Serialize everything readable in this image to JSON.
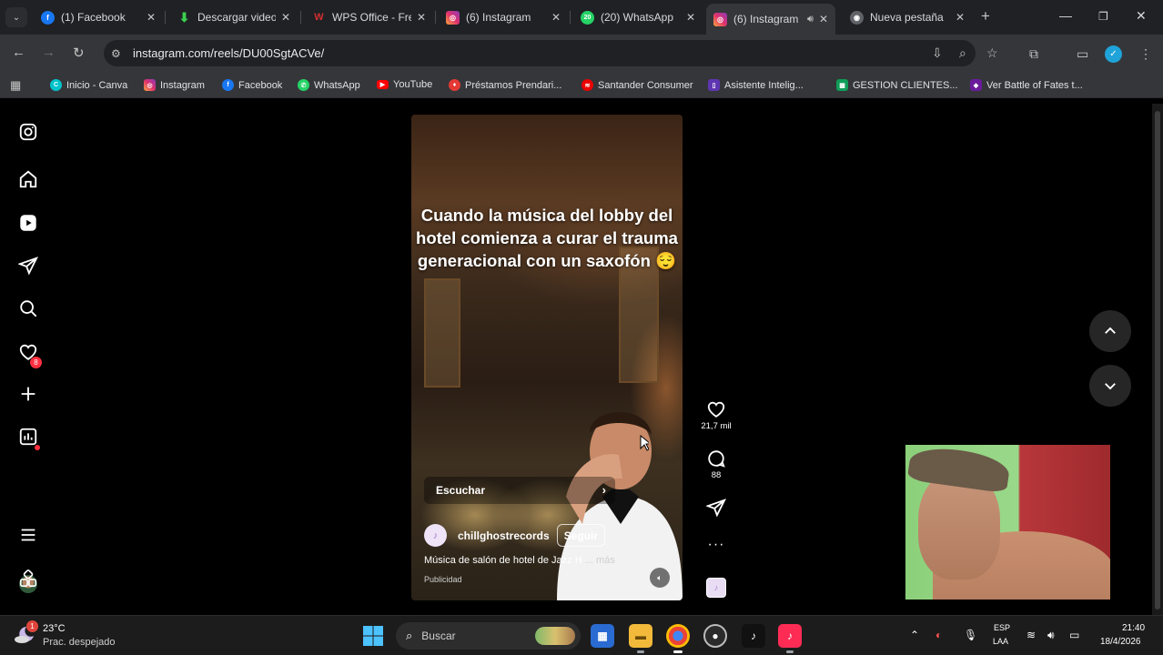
{
  "browser": {
    "tabs": [
      {
        "title": "(1) Facebook",
        "favicon": "facebook-icon",
        "color": "#1877f2"
      },
      {
        "title": "Descargar videos",
        "favicon": "download-icon",
        "color": "#3ccf4e"
      },
      {
        "title": "WPS Office - Fre",
        "favicon": "wps-icon",
        "color": "#d32f2f"
      },
      {
        "title": "(6) Instagram",
        "favicon": "instagram-icon",
        "color": "#e1306c"
      },
      {
        "title": "(20) WhatsApp",
        "favicon": "whatsapp-icon",
        "color": "#25d366",
        "badge": "20"
      },
      {
        "title": "(6) Instagram",
        "favicon": "instagram-icon",
        "color": "#e1306c",
        "active": true
      },
      {
        "title": "Nueva pestaña",
        "favicon": "chrome-icon",
        "color": "#9aa0a6"
      }
    ],
    "url": "instagram.com/reels/DU00SgtACVe/",
    "profile_initial": "✓",
    "bookmarks": [
      {
        "label": "Inicio - Canva",
        "icon": "canva-icon",
        "color": "#00c4cc"
      },
      {
        "label": "Instagram",
        "icon": "instagram-icon",
        "color": "#e1306c"
      },
      {
        "label": "Facebook",
        "icon": "facebook-icon",
        "color": "#1877f2"
      },
      {
        "label": "WhatsApp",
        "icon": "whatsapp-icon",
        "color": "#25d366"
      },
      {
        "label": "YouTube",
        "icon": "youtube-icon",
        "color": "#ff0000"
      },
      {
        "label": "Préstamos Prendari...",
        "icon": "pawn-icon",
        "color": "#e53935"
      },
      {
        "label": "Santander Consumer",
        "icon": "santander-icon",
        "color": "#ec0000"
      },
      {
        "label": "Asistente Intelig...",
        "icon": "assistant-icon",
        "color": "#5e35b1"
      },
      {
        "label": "GESTION CLIENTES...",
        "icon": "sheets-icon",
        "color": "#0f9d58"
      },
      {
        "label": "Ver Battle of Fates t...",
        "icon": "battle-icon",
        "color": "#6a1b9a"
      }
    ]
  },
  "instagram": {
    "sidebar": {
      "notification_badge": "8"
    },
    "reel": {
      "caption": "Cuando la música del lobby del hotel comienza a curar el trauma generacional con un saxofón 😌",
      "listen_label": "Escuchar",
      "username": "chillghostrecords",
      "follow_label": "Seguir",
      "description": "Música de salón de hotel de Jazz H",
      "more_label": "... más",
      "sponsored_label": "Publicidad"
    },
    "actions": {
      "likes": "21,7 mil",
      "comments": "88"
    }
  },
  "taskbar": {
    "weather_badge": "1",
    "temperature": "23°C",
    "condition": "Prac. despejado",
    "search_label": "Buscar",
    "lang_line1": "ESP",
    "lang_line2": "LAA",
    "time": "21:40",
    "date": "18/4/2026"
  }
}
